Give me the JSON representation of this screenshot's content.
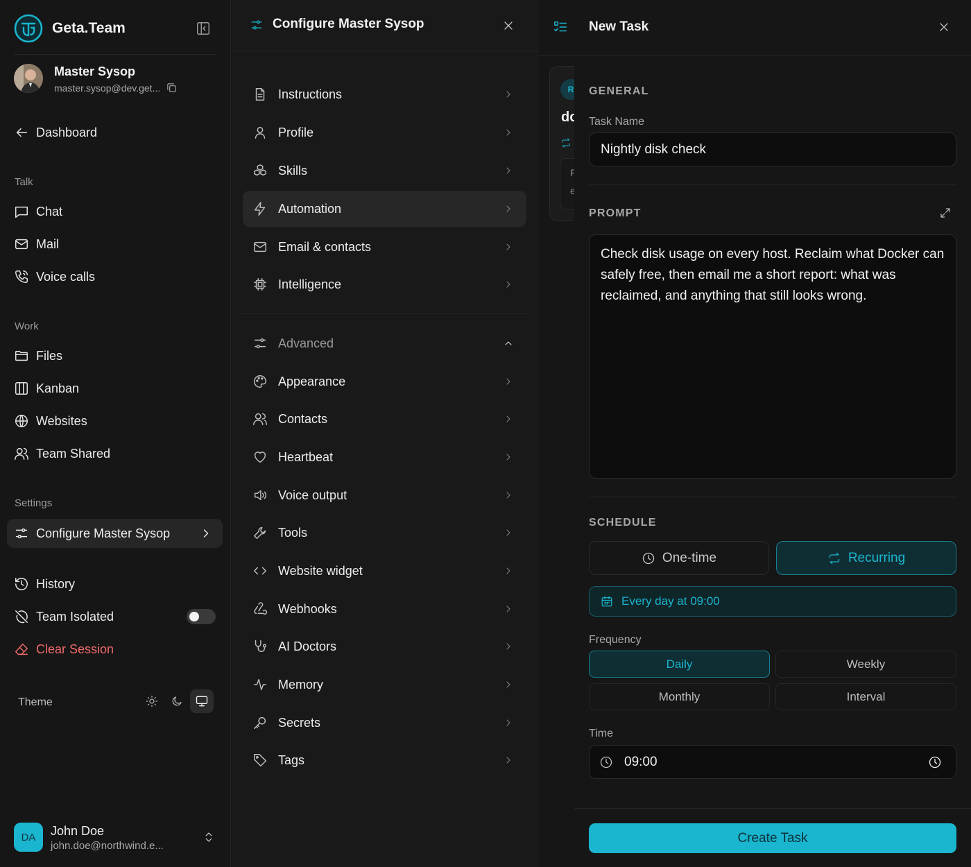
{
  "app": {
    "name": "Geta.Team"
  },
  "account": {
    "name": "Master Sysop",
    "email": "master.sysop@dev.get..."
  },
  "sidebar": {
    "dashboard": "Dashboard",
    "talk_label": "Talk",
    "talk": [
      "Chat",
      "Mail",
      "Voice calls"
    ],
    "work_label": "Work",
    "work": [
      "Files",
      "Kanban",
      "Websites",
      "Team Shared"
    ],
    "settings_label": "Settings",
    "configure": "Configure Master Sysop",
    "history": "History",
    "team_isolated": "Team Isolated",
    "team_isolated_on": false,
    "clear_session": "Clear Session",
    "theme_label": "Theme",
    "theme_active": "system"
  },
  "user": {
    "initials": "DA",
    "name": "John Doe",
    "email": "john.doe@northwind.e..."
  },
  "config_panel": {
    "title": "Configure Master Sysop",
    "items": [
      {
        "label": "Instructions",
        "icon": "document-icon"
      },
      {
        "label": "Profile",
        "icon": "user-icon"
      },
      {
        "label": "Skills",
        "icon": "skills-icon"
      },
      {
        "label": "Automation",
        "icon": "bolt-icon",
        "active": true
      },
      {
        "label": "Email & contacts",
        "icon": "mail-icon"
      },
      {
        "label": "Intelligence",
        "icon": "chip-icon"
      }
    ],
    "advanced_label": "Advanced",
    "advanced_items": [
      {
        "label": "Appearance",
        "icon": "palette-icon"
      },
      {
        "label": "Contacts",
        "icon": "users-icon"
      },
      {
        "label": "Heartbeat",
        "icon": "heart-icon"
      },
      {
        "label": "Voice output",
        "icon": "speaker-icon"
      },
      {
        "label": "Tools",
        "icon": "wrench-icon"
      },
      {
        "label": "Website widget",
        "icon": "code-icon"
      },
      {
        "label": "Webhooks",
        "icon": "webhook-icon"
      },
      {
        "label": "AI Doctors",
        "icon": "stethoscope-icon"
      },
      {
        "label": "Memory",
        "icon": "pulse-icon"
      },
      {
        "label": "Secrets",
        "icon": "key-icon"
      },
      {
        "label": "Tags",
        "icon": "tag-icon"
      }
    ]
  },
  "bg_card": {
    "badge": "R",
    "title": "dc",
    "line1": "F",
    "line2": "e"
  },
  "task_panel": {
    "title": "New Task",
    "general_label": "GENERAL",
    "task_name_label": "Task Name",
    "task_name_value": "Nightly disk check",
    "prompt_label": "PROMPT",
    "prompt_value": "Check disk usage on every host. Reclaim what Docker can safely free, then email me a short report: what was reclaimed, and anything that still looks wrong.",
    "schedule_label": "SCHEDULE",
    "mode_onetime": "One-time",
    "mode_recurring": "Recurring",
    "mode_selected": "Recurring",
    "schedule_summary": "Every day at 09:00",
    "frequency_label": "Frequency",
    "frequency_options": [
      "Daily",
      "Weekly",
      "Monthly",
      "Interval"
    ],
    "frequency_selected": "Daily",
    "time_label": "Time",
    "time_value": "09:00",
    "create_button": "Create Task"
  },
  "colors": {
    "accent": "#1ab5cf",
    "danger": "#f06a6a",
    "background": "#161616"
  }
}
